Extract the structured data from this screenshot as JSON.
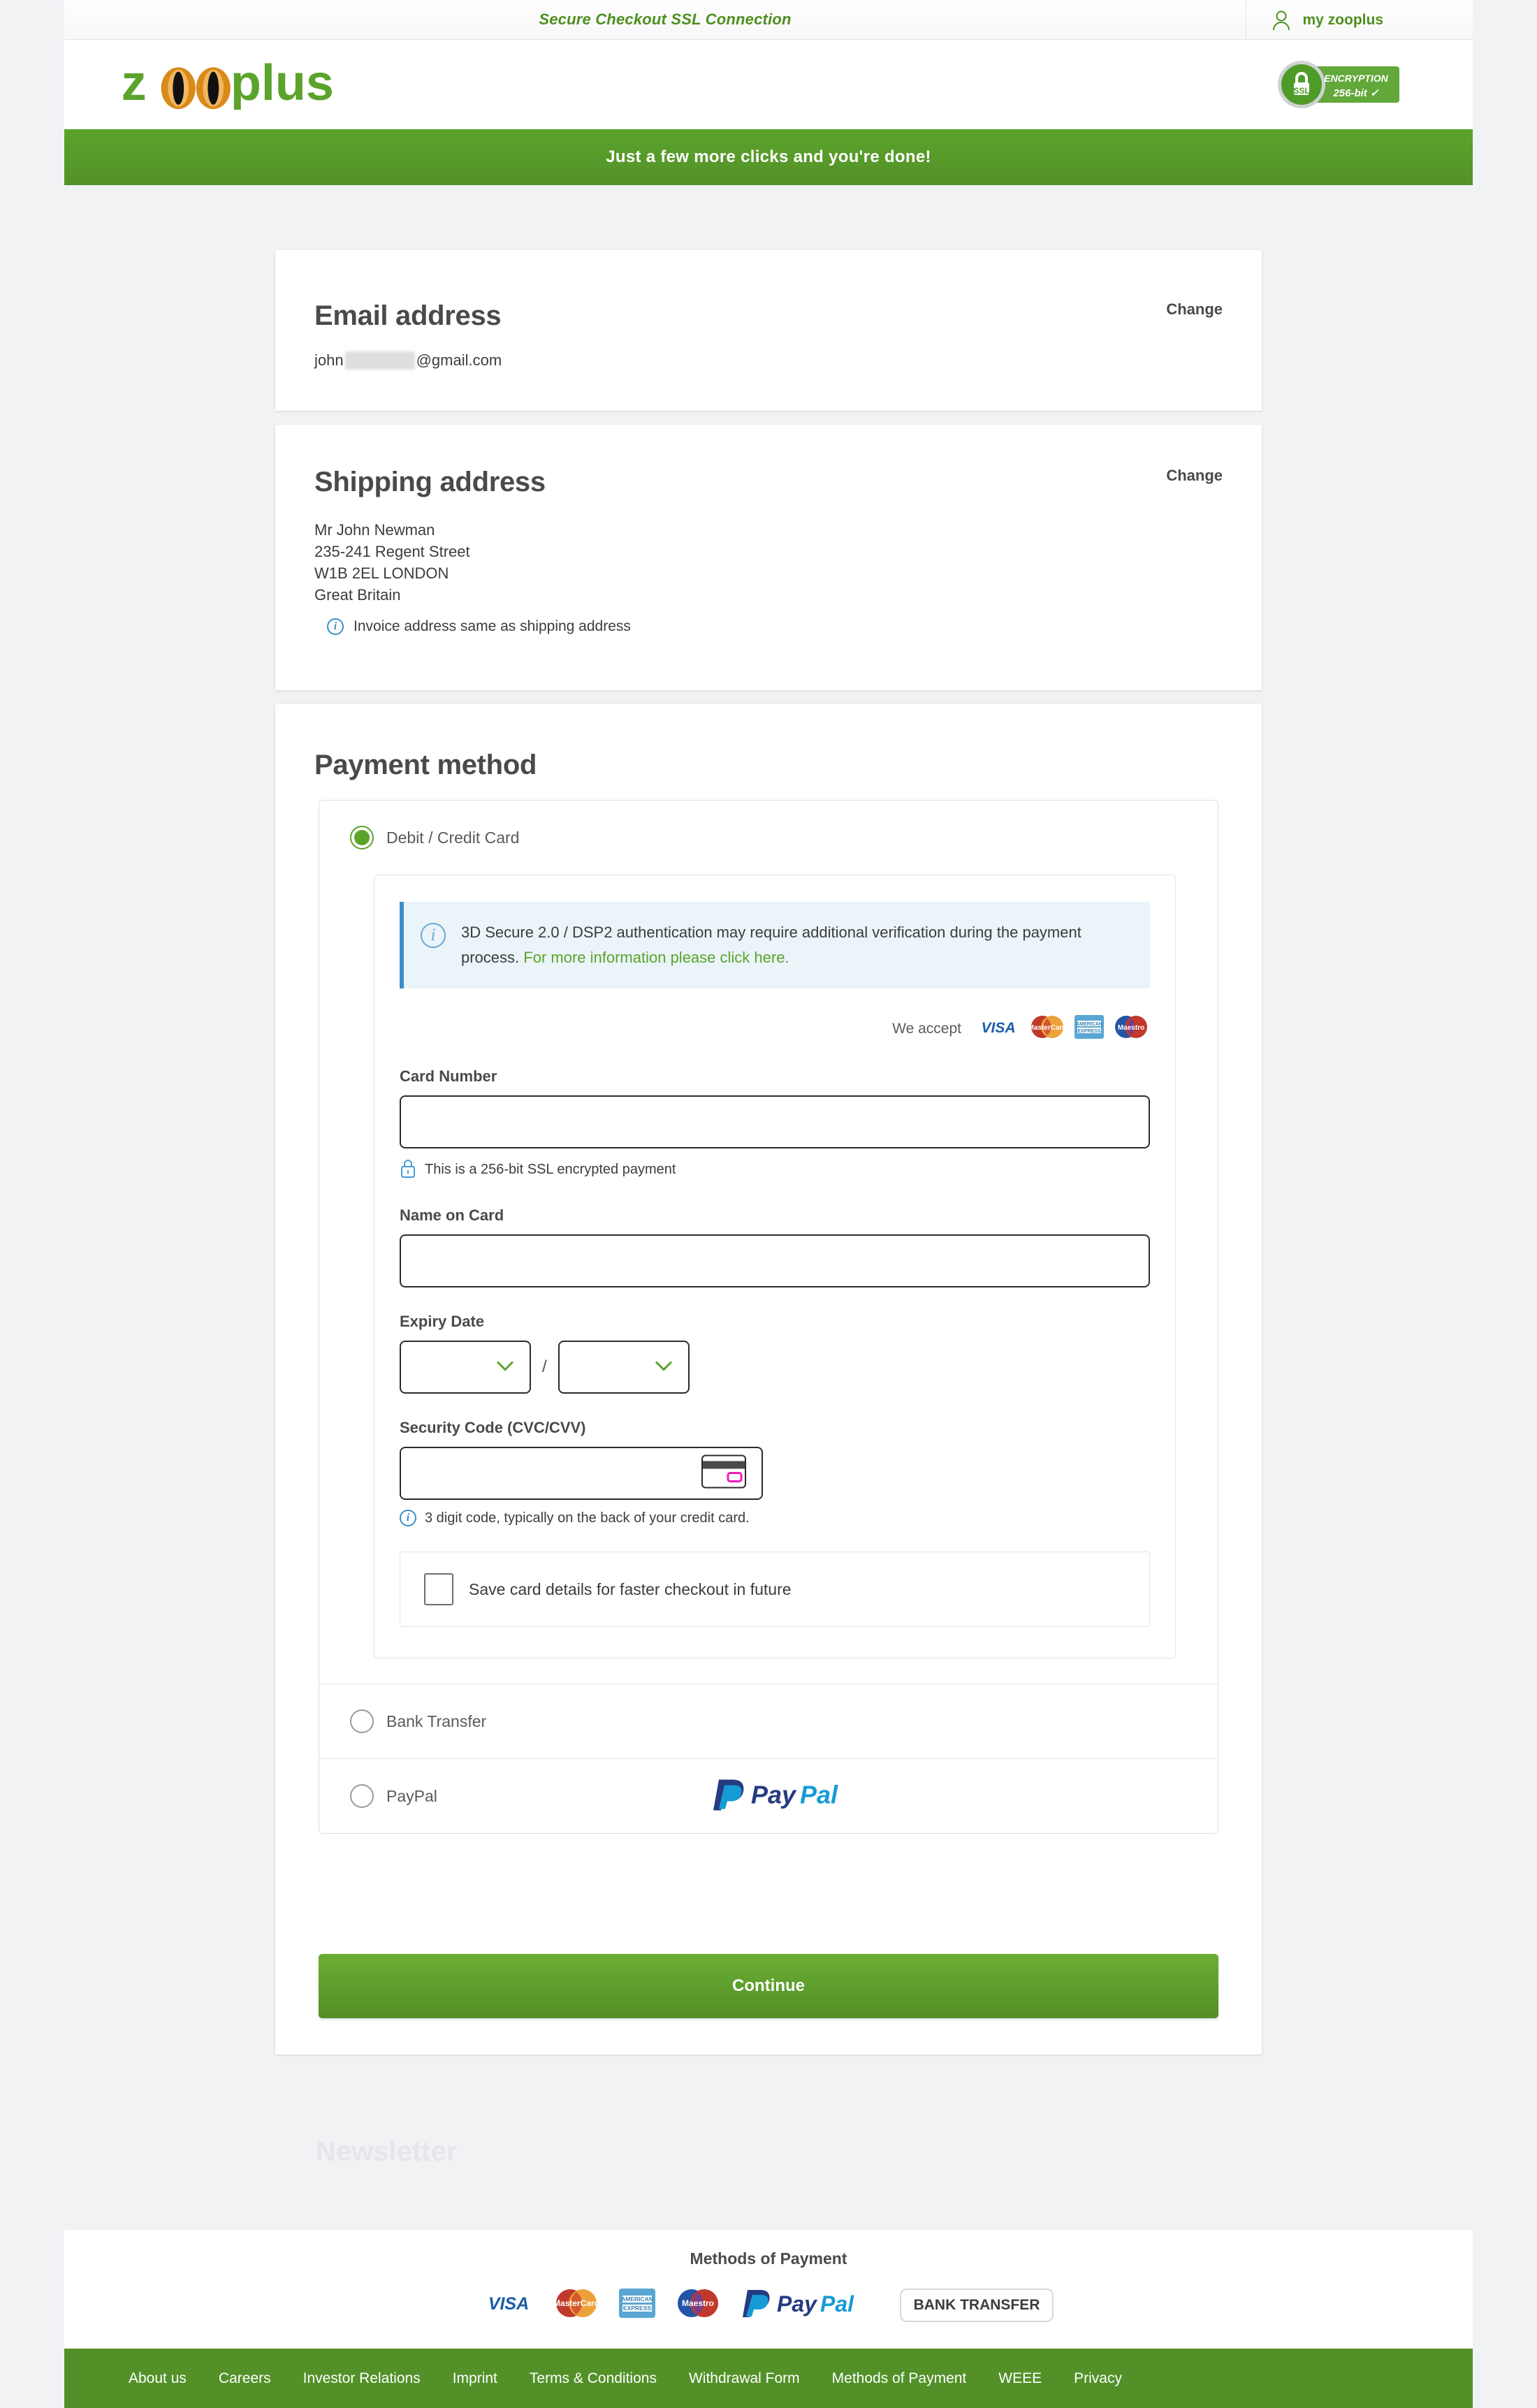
{
  "header": {
    "ssl_claim": "Secure Checkout SSL Connection",
    "my_account_label": "my zooplus",
    "logo_text": "zooplus",
    "ssl_badge": {
      "lock_label": "SSL",
      "line1": "ENCRYPTION",
      "line2": "256-bit ✓"
    }
  },
  "progress_banner": {
    "text": "Just a few more clicks and you're done!"
  },
  "email_section": {
    "title": "Email address",
    "change_label": "Change",
    "value_prefix": "john",
    "value_suffix": "@gmail.com"
  },
  "shipping_section": {
    "title": "Shipping address",
    "change_label": "Change",
    "lines": [
      "Mr John Newman",
      "235-241 Regent Street",
      "W1B 2EL LONDON",
      "Great Britain"
    ],
    "invoice_note": "Invoice address same as shipping address"
  },
  "payment_section": {
    "title": "Payment method",
    "methods": [
      {
        "id": "card",
        "label": "Debit / Credit Card",
        "selected": true
      },
      {
        "id": "bank",
        "label": "Bank Transfer",
        "selected": false
      },
      {
        "id": "paypal",
        "label": "PayPal",
        "selected": false
      }
    ],
    "alert_3ds": {
      "text_before": "3D Secure 2.0 / DSP2 authentication may require additional verification during the payment process.",
      "link_text": "For more information please click here."
    },
    "we_accept_label": "We accept",
    "accepted_cards": [
      "VISA",
      "MasterCard",
      "AMERICAN EXPRESS",
      "Maestro"
    ],
    "card_number_label": "Card Number",
    "card_number_value": "",
    "ssl_hint": "This is a 256-bit SSL encrypted payment",
    "name_on_card_label": "Name on Card",
    "name_on_card_value": "",
    "expiry_label": "Expiry Date",
    "expiry_month_value": "",
    "expiry_year_value": "",
    "expiry_separator": "/",
    "security_code_label": "Security Code (CVC/CVV)",
    "security_code_value": "",
    "security_code_hint": "3 digit code, typically on the back of your credit card.",
    "save_card_label": "Save card details for faster checkout in future",
    "save_card_checked": false,
    "continue_label": "Continue"
  },
  "newsletter": {
    "title": "Newsletter"
  },
  "footer": {
    "payment_title": "Methods of Payment",
    "payment_logos": [
      "VISA",
      "MasterCard",
      "AMERICAN EXPRESS",
      "Maestro",
      "PayPal"
    ],
    "bank_transfer_label": "BANK TRANSFER",
    "links": [
      "About us",
      "Careers",
      "Investor Relations",
      "Imprint",
      "Terms & Conditions",
      "Withdrawal Form",
      "Methods of Payment",
      "WEEE",
      "Privacy"
    ]
  },
  "colors": {
    "brand_green": "#5ba32b",
    "dark_green": "#539128",
    "page_bg": "#f1f2f4",
    "info_blue": "#3a8ec9",
    "alert_bg": "#eaf4f9"
  }
}
